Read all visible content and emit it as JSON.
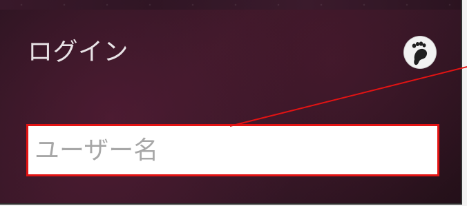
{
  "login_panel": {
    "title": "ログイン",
    "username_field": {
      "value": "",
      "placeholder": "ユーザー名"
    },
    "badge_icon": "gnome-foot-icon"
  },
  "annotation": {
    "callout_color": "#e31313"
  }
}
